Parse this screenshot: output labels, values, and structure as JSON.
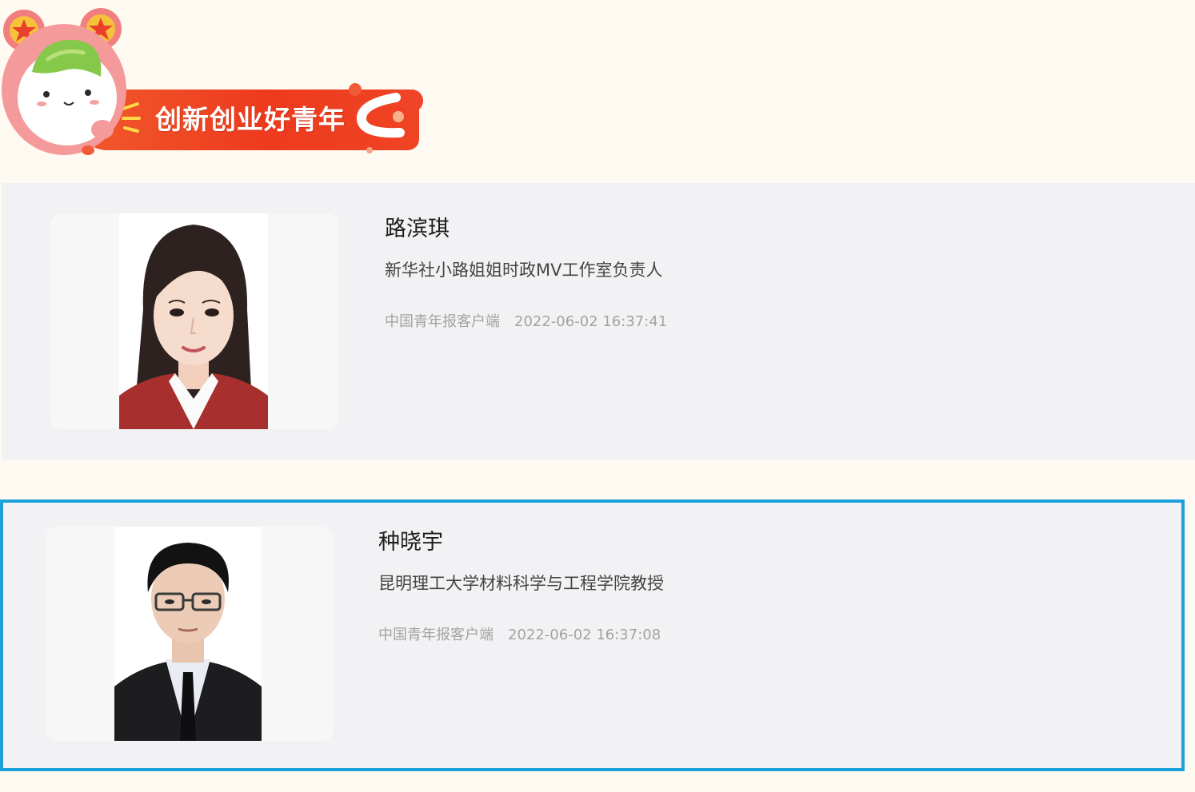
{
  "header": {
    "banner_title": "创新创业好青年"
  },
  "articles": [
    {
      "name": "路滨琪",
      "title": "新华社小路姐姐时政MV工作室负责人",
      "source": "中国青年报客户端",
      "datetime": "2022-06-02 16:37:41"
    },
    {
      "name": "种晓宇",
      "title": "昆明理工大学材料科学与工程学院教授",
      "source": "中国青年报客户端",
      "datetime": "2022-06-02 16:37:08"
    }
  ],
  "colors": {
    "page_bg": "#fffaf1",
    "banner_red": "#ee3a1e",
    "card_bg": "#f2f2f4",
    "selection_border": "#1ba0da"
  }
}
